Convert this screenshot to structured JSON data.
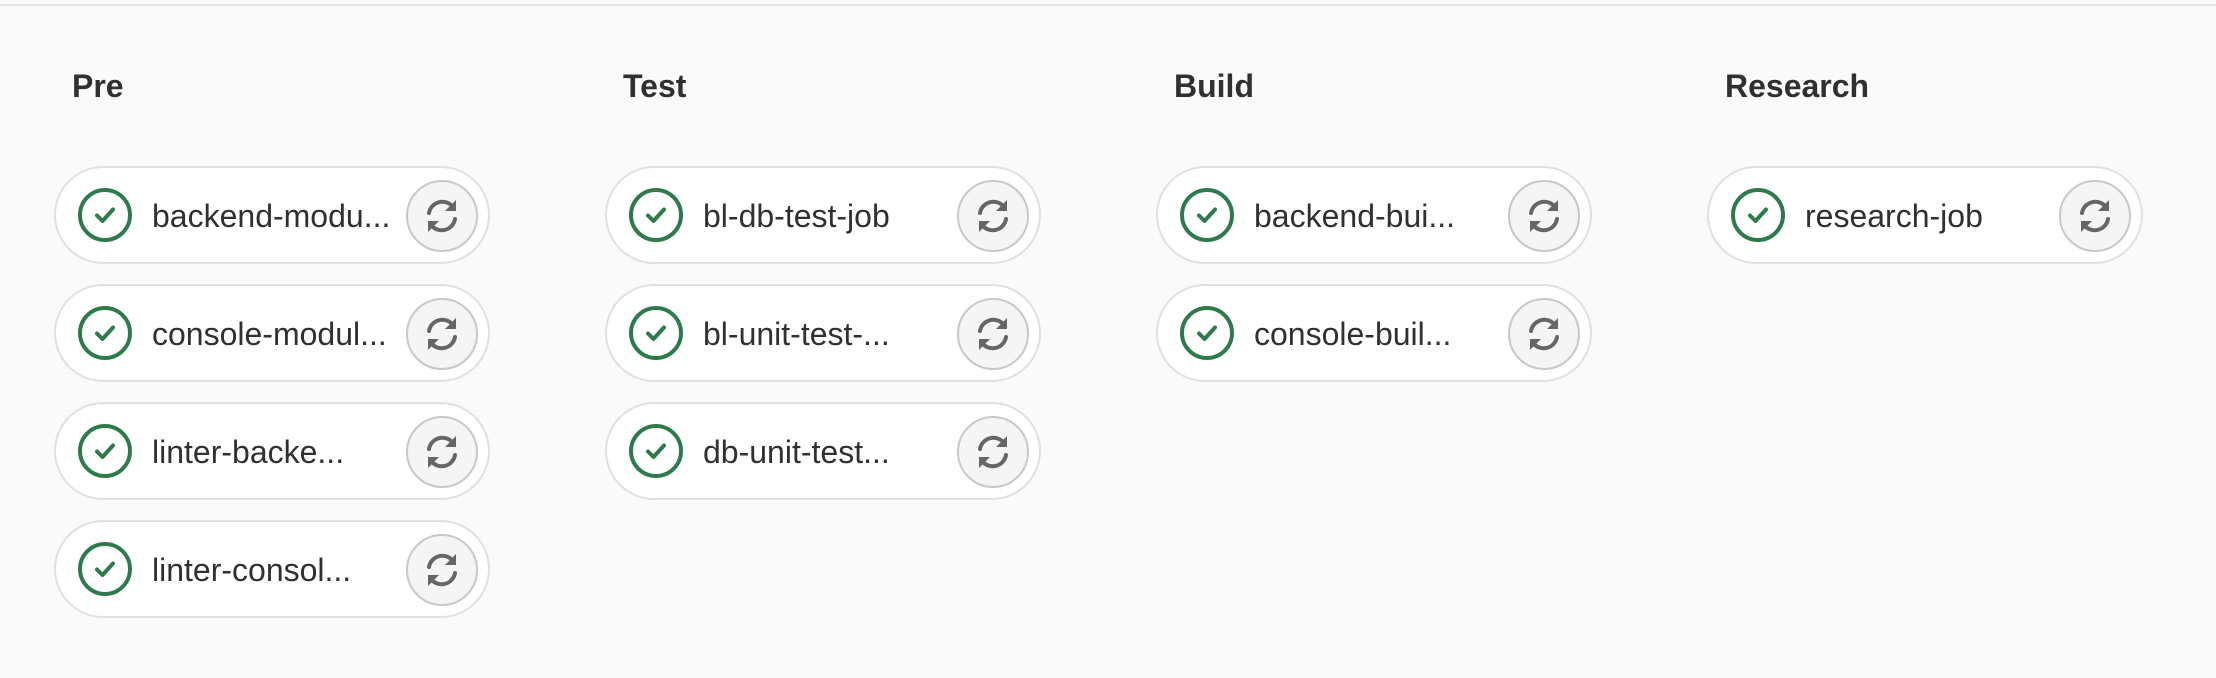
{
  "colors": {
    "background": "#fafafa",
    "success": "#2d7a4a",
    "retry_icon": "#666666",
    "text": "#303030"
  },
  "stages": [
    {
      "title": "Pre",
      "jobs": [
        {
          "name": "backend-modu...",
          "status": "success",
          "status_icon": "check-circle-icon",
          "action_icon": "retry-icon"
        },
        {
          "name": "console-modul...",
          "status": "success",
          "status_icon": "check-circle-icon",
          "action_icon": "retry-icon"
        },
        {
          "name": "linter-backe...",
          "status": "success",
          "status_icon": "check-circle-icon",
          "action_icon": "retry-icon"
        },
        {
          "name": "linter-consol...",
          "status": "success",
          "status_icon": "check-circle-icon",
          "action_icon": "retry-icon"
        }
      ]
    },
    {
      "title": "Test",
      "jobs": [
        {
          "name": "bl-db-test-job",
          "status": "success",
          "status_icon": "check-circle-icon",
          "action_icon": "retry-icon"
        },
        {
          "name": "bl-unit-test-...",
          "status": "success",
          "status_icon": "check-circle-icon",
          "action_icon": "retry-icon"
        },
        {
          "name": "db-unit-test...",
          "status": "success",
          "status_icon": "check-circle-icon",
          "action_icon": "retry-icon"
        }
      ]
    },
    {
      "title": "Build",
      "jobs": [
        {
          "name": "backend-bui...",
          "status": "success",
          "status_icon": "check-circle-icon",
          "action_icon": "retry-icon"
        },
        {
          "name": "console-buil...",
          "status": "success",
          "status_icon": "check-circle-icon",
          "action_icon": "retry-icon"
        }
      ]
    },
    {
      "title": "Research",
      "jobs": [
        {
          "name": "research-job",
          "status": "success",
          "status_icon": "check-circle-icon",
          "action_icon": "retry-icon"
        }
      ]
    }
  ]
}
